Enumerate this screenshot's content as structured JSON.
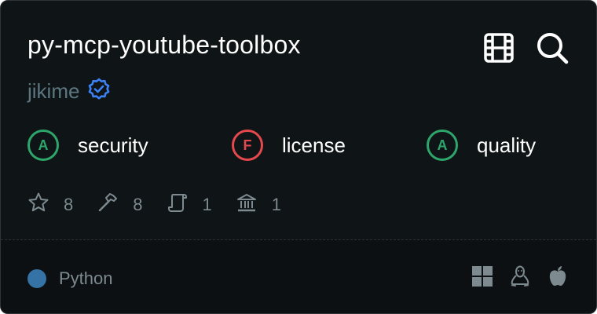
{
  "server": {
    "name": "py-mcp-youtube-toolbox",
    "owner": "jikime",
    "verified": true
  },
  "header_icons": [
    "film-icon",
    "search-icon"
  ],
  "scores": [
    {
      "grade": "A",
      "label": "security",
      "status": "good"
    },
    {
      "grade": "F",
      "label": "license",
      "status": "bad"
    },
    {
      "grade": "A",
      "label": "quality",
      "status": "good"
    }
  ],
  "stats": {
    "stars": "8",
    "tools": "8",
    "prompts": "1",
    "resources": "1"
  },
  "footer": {
    "language": "Python",
    "language_color": "#3572a5",
    "platforms": [
      "windows-icon",
      "linux-icon",
      "apple-icon"
    ]
  },
  "colors": {
    "background": "#0f1416",
    "good": "#2ea56a",
    "bad": "#e5484d",
    "verified": "#3b82f6"
  }
}
